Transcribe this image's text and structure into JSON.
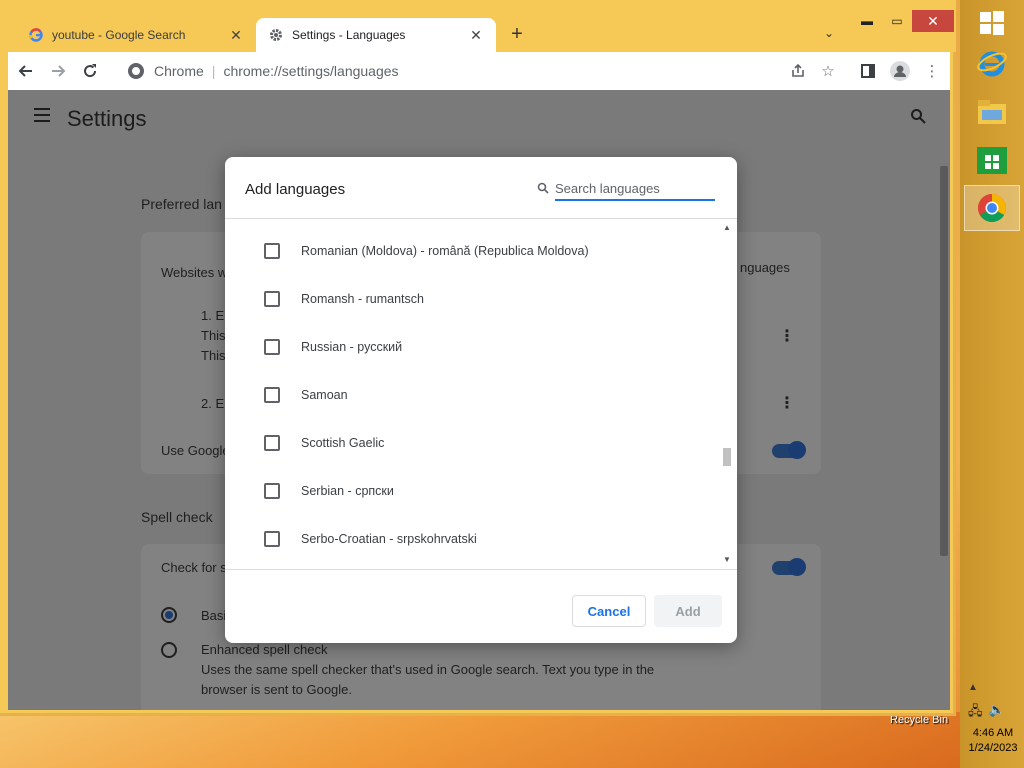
{
  "browser": {
    "tabs": [
      {
        "title": "youtube - Google Search",
        "favicon": "G"
      },
      {
        "title": "Settings - Languages",
        "favicon": "gear-icon"
      }
    ],
    "omnibox": {
      "site_label": "Chrome",
      "url": "chrome://settings/languages"
    }
  },
  "settings": {
    "title": "Settings",
    "background_fragments": {
      "preferred_heading": "Preferred lan",
      "websites_text": "Websites w",
      "lang1": "1. En",
      "lang1_line1": "This",
      "lang1_line2": "This",
      "lang2": "2. En",
      "add_languages_fragment": "nguages",
      "use_google": "Use Google",
      "spell_check": "Spell check",
      "check_for": "Check for s",
      "basic": "Basi",
      "enhanced_title": "Enhanced spell check",
      "enhanced_desc1": "Uses the same spell checker that's used in Google search. Text you type in the",
      "enhanced_desc2": "browser is sent to Google."
    }
  },
  "dialog": {
    "title": "Add languages",
    "search_placeholder": "Search languages",
    "languages": [
      "Romanian (Moldova) - română (Republica Moldova)",
      "Romansh - rumantsch",
      "Russian - русский",
      "Samoan",
      "Scottish Gaelic",
      "Serbian - српски",
      "Serbo-Croatian - srpskohrvatski"
    ],
    "cancel_label": "Cancel",
    "add_label": "Add"
  },
  "desktop": {
    "recycle_bin": "Recycle Bin"
  },
  "taskbar": {
    "time": "4:46 AM",
    "date": "1/24/2023"
  },
  "colors": {
    "accent_blue": "#1a73e8",
    "window_frame": "#f6c957",
    "close_red": "#c7463d"
  }
}
